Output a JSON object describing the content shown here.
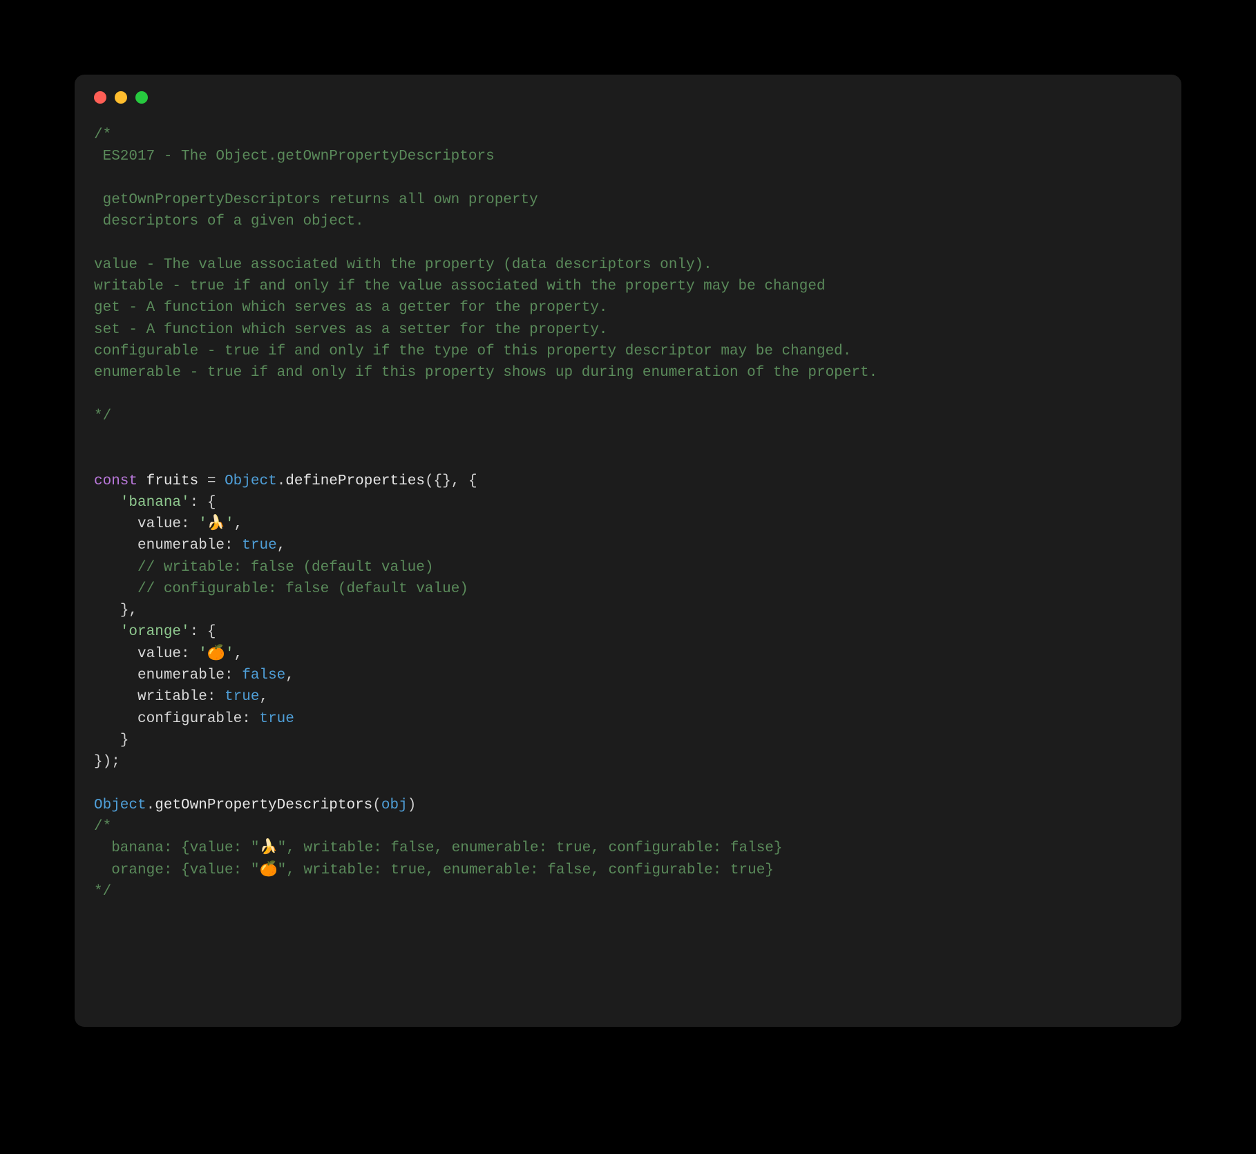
{
  "comment_block_1": {
    "l1": "/*",
    "l2": " ES2017 - The Object.getOwnPropertyDescriptors",
    "l3": "",
    "l4": " getOwnPropertyDescriptors returns all own property",
    "l5": " descriptors of a given object.",
    "l6": "",
    "l7": "value - The value associated with the property (data descriptors only).",
    "l8": "writable - true if and only if the value associated with the property may be changed",
    "l9": "get - A function which serves as a getter for the property.",
    "l10": "set - A function which serves as a setter for the property.",
    "l11": "configurable - true if and only if the type of this property descriptor may be changed.",
    "l12": "enumerable - true if and only if this property shows up during enumeration of the propert.",
    "l13": "",
    "l14": "*/"
  },
  "code": {
    "kw_const": "const",
    "var_fruits": "fruits",
    "eq": " = ",
    "cls_object": "Object",
    "dot": ".",
    "fn_define": "defineProperties",
    "open_args": "({}, {",
    "banana_key": "'banana'",
    "colon_brace": ": {",
    "value_label": "value",
    "banana_val": "'🍌'",
    "comma": ",",
    "enum_label": "enumerable",
    "true": "true",
    "false": "false",
    "cmt_writable": "// writable: false (default value)",
    "cmt_config": "// configurable: false (default value)",
    "close_brace": "}",
    "orange_key": "'orange'",
    "orange_val": "'🍊'",
    "writable_label": "writable",
    "config_label": "configurable",
    "close_all": "});",
    "fn_getdesc": "getOwnPropertyDescriptors",
    "arg_obj": "obj",
    "open_p": "(",
    "close_p": ")"
  },
  "comment_block_2": {
    "l1": "/*",
    "l2": "  banana: {value: \"🍌\", writable: false, enumerable: true, configurable: false}",
    "l3": "  orange: {value: \"🍊\", writable: true, enumerable: false, configurable: true}",
    "l4": "*/"
  }
}
